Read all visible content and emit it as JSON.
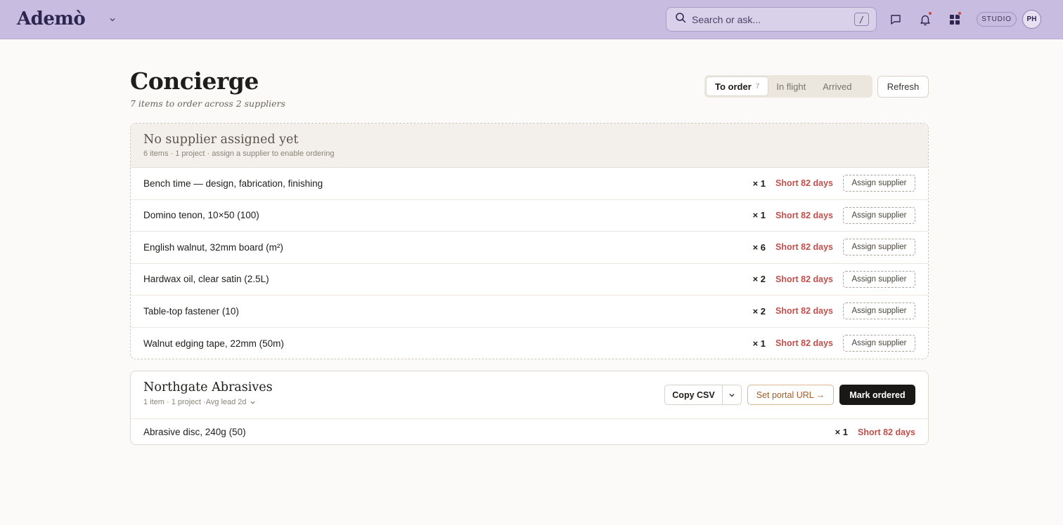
{
  "app": {
    "logo": "Ademò",
    "search_placeholder": "Search or ask...",
    "search_shortcut": "/",
    "studio_label": "STUDIO",
    "avatar_initials": "PH",
    "notification_dot_color": "#c94747"
  },
  "header": {
    "title": "Concierge",
    "subtitle": "7 items to order across 2 suppliers",
    "tabs": [
      {
        "label": "To order",
        "count": "7",
        "active": true
      },
      {
        "label": "In flight"
      },
      {
        "label": "Arrived"
      }
    ],
    "refresh_label": "Refresh"
  },
  "unassigned": {
    "title": "No supplier assigned yet",
    "meta": "6 items · 1 project · assign a supplier to enable ordering",
    "assign_label": "Assign supplier",
    "items": [
      {
        "name": "Bench time — design, fabrication, finishing",
        "qty": "× 1",
        "status": "Short 82 days"
      },
      {
        "name": "Domino tenon, 10×50 (100)",
        "qty": "× 1",
        "status": "Short 82 days"
      },
      {
        "name": "English walnut, 32mm board (m²)",
        "qty": "× 6",
        "status": "Short 82 days"
      },
      {
        "name": "Hardwax oil, clear satin (2.5L)",
        "qty": "× 2",
        "status": "Short 82 days"
      },
      {
        "name": "Table-top fastener (10)",
        "qty": "× 2",
        "status": "Short 82 days"
      },
      {
        "name": "Walnut edging tape, 22mm (50m)",
        "qty": "× 1",
        "status": "Short 82 days"
      }
    ]
  },
  "supplier": {
    "title": "Northgate Abrasives",
    "meta_prefix": "1 item · 1 project · ",
    "lead_label": "Avg lead 2d",
    "copy_csv_label": "Copy CSV",
    "portal_label": "Set portal URL →",
    "mark_ordered_label": "Mark ordered",
    "items": [
      {
        "name": "Abrasive disc, 240g (50)",
        "qty": "× 1",
        "status": "Short 82 days"
      }
    ]
  },
  "colors": {
    "topbar": "#c8bde1",
    "short_status": "#c0504b",
    "portal_accent": "#a45a22",
    "primary_button": "#1a1816"
  }
}
